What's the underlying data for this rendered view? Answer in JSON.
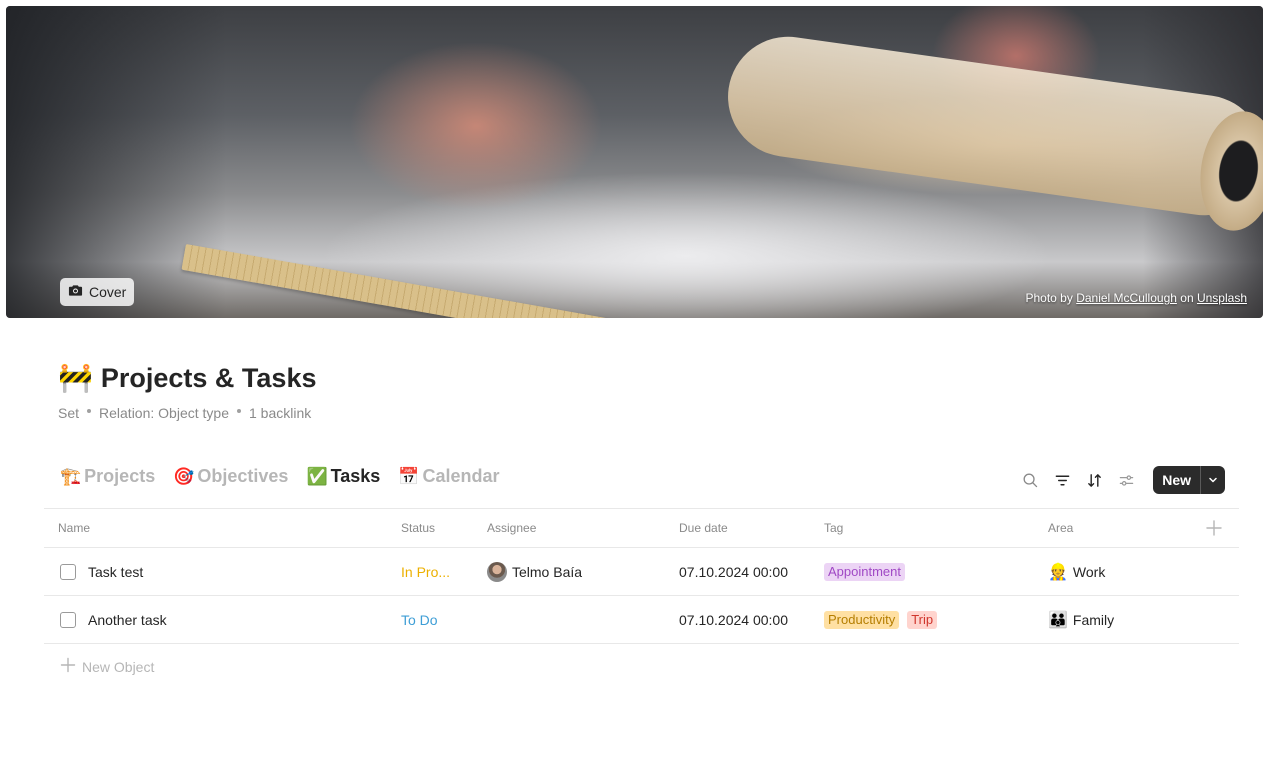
{
  "cover": {
    "button_label": "Cover",
    "credit_prefix": "Photo by",
    "credit_author": "Daniel McCullough",
    "credit_on": "on",
    "credit_source": "Unsplash"
  },
  "page": {
    "emoji": "🚧",
    "title": "Projects & Tasks",
    "meta": [
      "Set",
      "Relation: Object type",
      "1 backlink"
    ]
  },
  "views": [
    {
      "icon": "🏗️",
      "label": "Projects",
      "active": false
    },
    {
      "icon": "🎯",
      "label": "Objectives",
      "active": false
    },
    {
      "icon": "✅",
      "label": "Tasks",
      "active": true
    },
    {
      "icon": "📅",
      "label": "Calendar",
      "active": false
    }
  ],
  "toolbar": {
    "new_label": "New"
  },
  "table": {
    "columns": [
      "Name",
      "Status",
      "Assignee",
      "Due date",
      "Tag",
      "Area"
    ],
    "rows": [
      {
        "name": "Task test",
        "status": "In Pro...",
        "status_color": "#ecb000",
        "assignee": "Telmo Baía",
        "due": "07.10.2024 00:00",
        "tags": [
          {
            "label": "Appointment",
            "bg": "#ecd4f5",
            "fg": "#a049c5"
          }
        ],
        "area_icon": "👷",
        "area": "Work"
      },
      {
        "name": "Another task",
        "status": "To Do",
        "status_color": "#3e9ed6",
        "assignee": "",
        "due": "07.10.2024 00:00",
        "tags": [
          {
            "label": "Productivity",
            "bg": "#ffe0a3",
            "fg": "#b57e00"
          },
          {
            "label": "Trip",
            "bg": "#ffd4ce",
            "fg": "#d0362d"
          }
        ],
        "area_icon": "👪",
        "area": "Family"
      }
    ],
    "new_object_label": "New Object"
  }
}
